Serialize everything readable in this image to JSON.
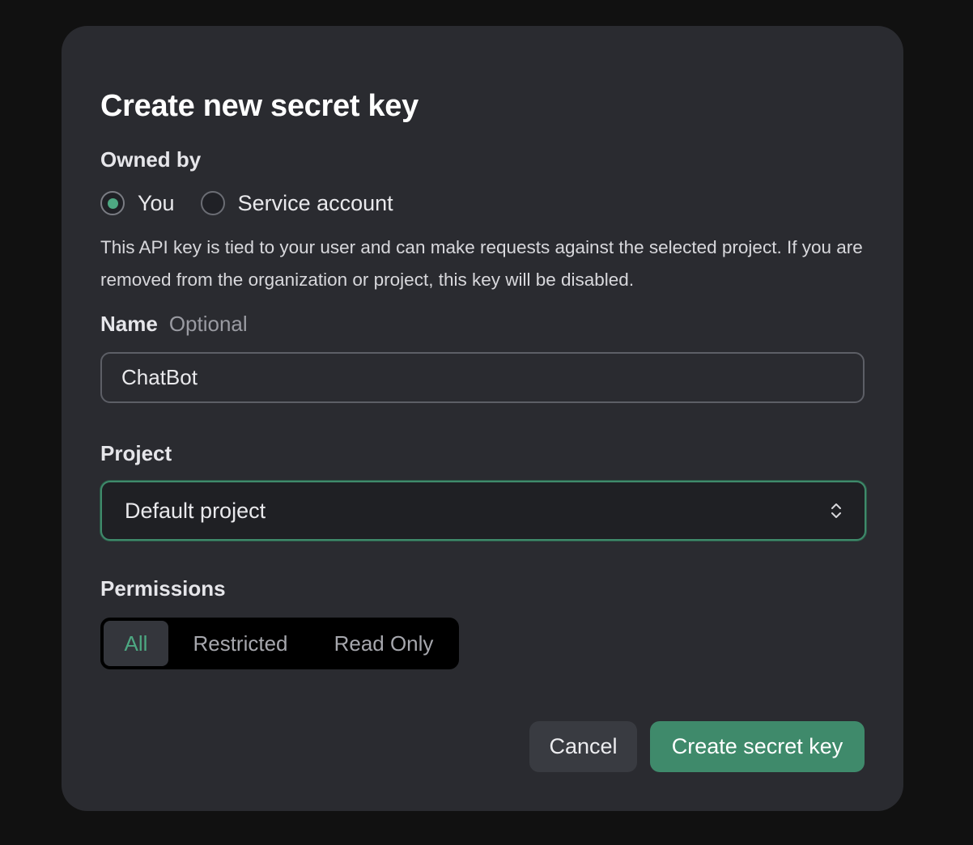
{
  "dialog": {
    "title": "Create new secret key"
  },
  "owned_by": {
    "label": "Owned by",
    "options": [
      {
        "label": "You",
        "checked": true
      },
      {
        "label": "Service account",
        "checked": false
      }
    ],
    "description": "This API key is tied to your user and can make requests against the selected project. If you are removed from the organization or project, this key will be disabled."
  },
  "name": {
    "label": "Name",
    "optional_label": "Optional",
    "value": "ChatBot"
  },
  "project": {
    "label": "Project",
    "selected": "Default project"
  },
  "permissions": {
    "label": "Permissions",
    "options": [
      "All",
      "Restricted",
      "Read Only"
    ],
    "selected": "All"
  },
  "buttons": {
    "cancel": "Cancel",
    "create": "Create secret key"
  },
  "colors": {
    "accent": "#4da882",
    "primary_button": "#3f8a6b",
    "dialog_background": "#2a2b30",
    "page_background": "#111111"
  },
  "icons": {
    "select_chevron": "chevron-up-down-icon"
  }
}
